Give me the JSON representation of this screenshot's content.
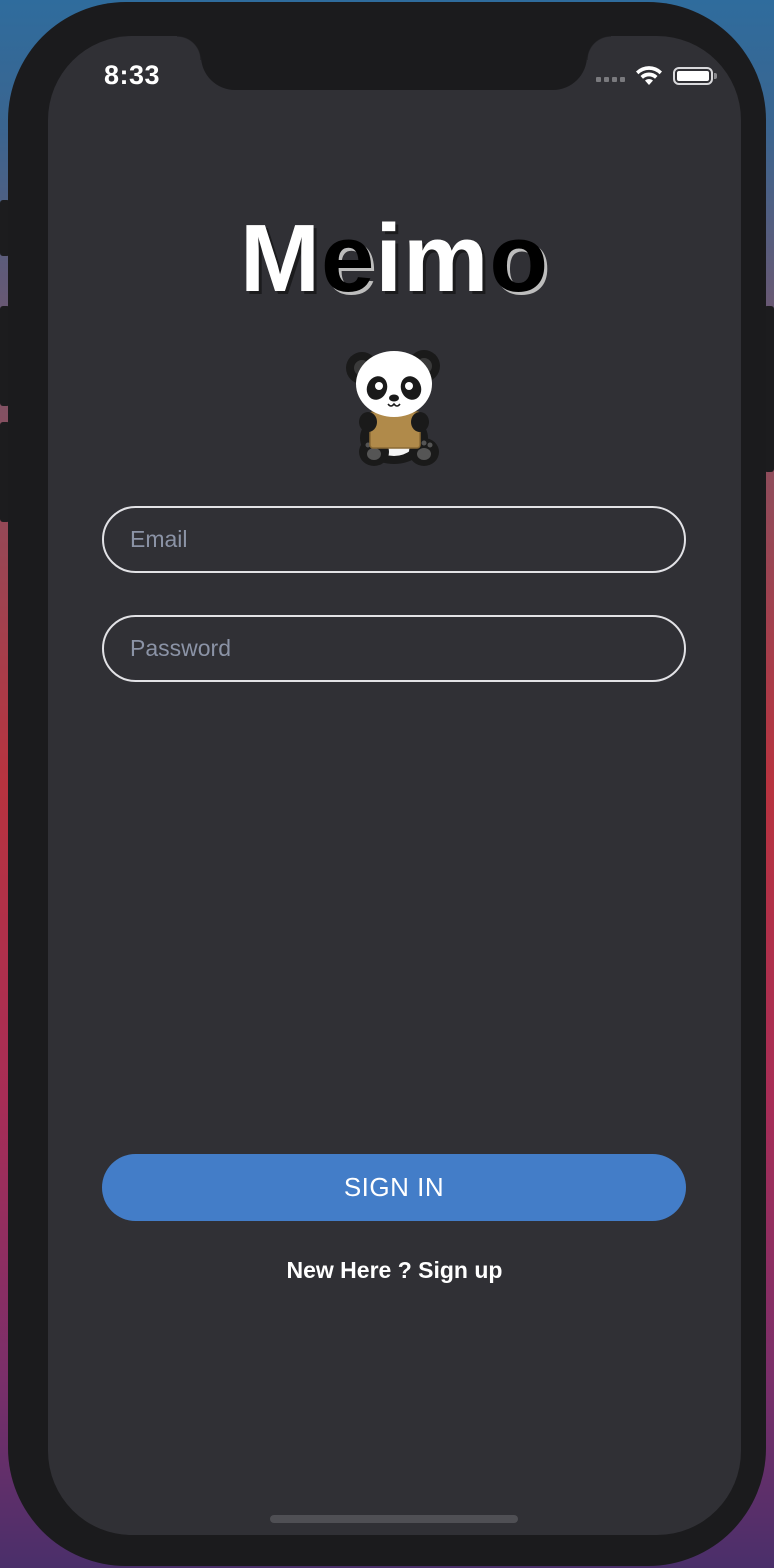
{
  "status_bar": {
    "time": "8:33",
    "icons": [
      "signal-icon",
      "wifi-icon",
      "battery-icon"
    ]
  },
  "app": {
    "title_letters": [
      "M",
      "e",
      "i",
      "m",
      "o"
    ],
    "logo": "panda-icon"
  },
  "form": {
    "email_placeholder": "Email",
    "email_value": "",
    "password_placeholder": "Password",
    "password_value": ""
  },
  "actions": {
    "sign_in_label": "SIGN IN",
    "signup_prompt": "New Here ? Sign up"
  },
  "colors": {
    "screen_background": "#303035",
    "accent": "#437dc8",
    "placeholder_text": "#8b93a6",
    "field_border": "#e2e2e6"
  }
}
